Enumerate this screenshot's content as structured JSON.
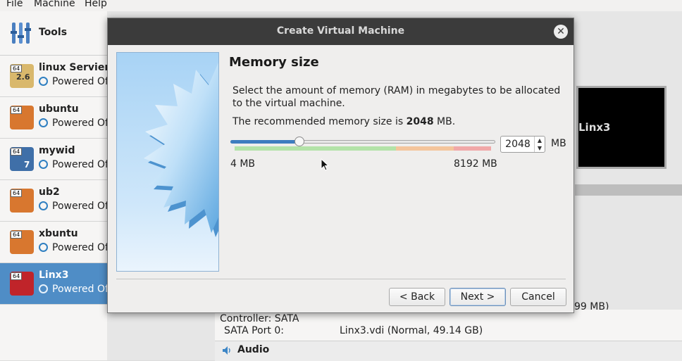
{
  "menu": {
    "file": "File",
    "machine": "Machine",
    "help": "Help"
  },
  "sidebar": {
    "tools_label": "Tools",
    "vms": [
      {
        "name": "linux Servier",
        "state": "Powered Off",
        "badge": "64",
        "version": "2.6"
      },
      {
        "name": "ubuntu",
        "state": "Powered Off",
        "badge": "64"
      },
      {
        "name": "mywid",
        "state": "Powered Off",
        "badge": "64",
        "version": "7"
      },
      {
        "name": "ub2",
        "state": "Powered Off",
        "badge": "64"
      },
      {
        "name": "xbuntu",
        "state": "Powered Off",
        "badge": "64"
      },
      {
        "name": "Linx3",
        "state": "Powered Off",
        "badge": "64",
        "selected": true
      }
    ]
  },
  "details": {
    "preview_label": "Linx3",
    "truncated_size": "99 MB)",
    "controller": "Controller: SATA",
    "sata_port_label": "SATA Port 0:",
    "sata_port_value": "Linx3.vdi (Normal, 49.14 GB)",
    "audio_label": "Audio"
  },
  "dialog": {
    "title": "Create Virtual Machine",
    "heading": "Memory size",
    "description": "Select the amount of memory (RAM) in megabytes to be allocated to the virtual machine.",
    "recommend_prefix": "The recommended memory size is ",
    "recommend_value": "2048",
    "recommend_suffix": " MB.",
    "memory": {
      "min": 4,
      "max": 8192,
      "value": 2048,
      "value_text": "2048",
      "unit": "MB",
      "min_label": "4 MB",
      "max_label": "8192 MB",
      "slider_fraction": 0.26
    },
    "buttons": {
      "back": "< Back",
      "next": "Next >",
      "cancel": "Cancel"
    }
  },
  "colors": {
    "accent": "#3e7dbf",
    "selected_row": "#4f8dc6",
    "titlebar": "#3b3b3b",
    "scale_green": "#b3e3a8",
    "scale_orange": "#f4c59c",
    "scale_red": "#f1a8a8"
  }
}
